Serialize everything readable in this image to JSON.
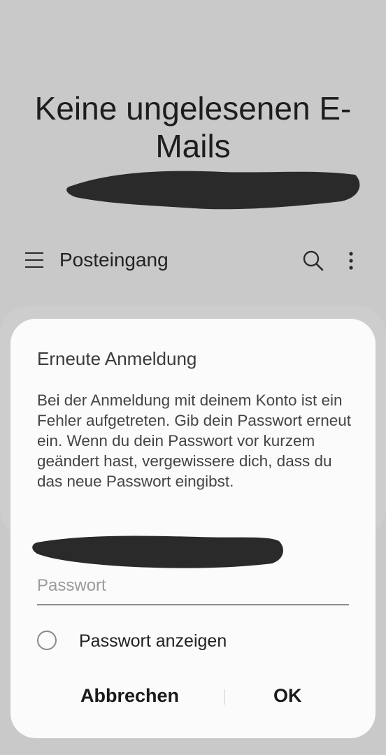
{
  "background": {
    "empty_state_title": "Keine ungelesenen E-Mails"
  },
  "toolbar": {
    "title": "Posteingang",
    "menu_icon": "hamburger-icon",
    "search_icon": "search-icon",
    "more_icon": "more-vertical-icon"
  },
  "dialog": {
    "title": "Erneute Anmeldung",
    "message": "Bei der Anmeldung mit deinem Konto ist ein Fehler aufgetreten. Gib dein Passwort erneut ein. Wenn du dein Passwort vor kurzem geändert hast, vergewissere dich, dass du das neue Passwort eingibst.",
    "password_placeholder": "Passwort",
    "password_value": "",
    "show_password_label": "Passwort anzeigen",
    "show_password_checked": false,
    "cancel_label": "Abbrechen",
    "ok_label": "OK"
  },
  "colors": {
    "backdrop": "#c9c9c9",
    "dialog_bg": "#fbfbfb",
    "redaction": "#2a2a2a"
  }
}
